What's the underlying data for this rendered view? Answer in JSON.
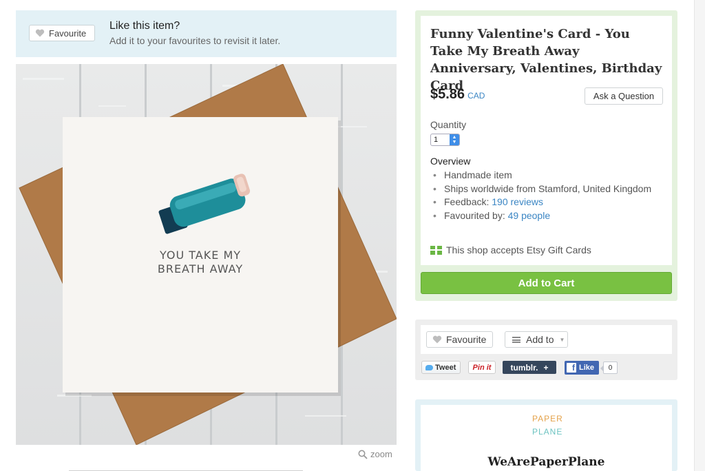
{
  "favourite_banner": {
    "button_label": "Favourite",
    "title": "Like this item?",
    "subtitle": "Add it to your favourites to revisit it later."
  },
  "product_image": {
    "card_text_line1": "YOU TAKE MY",
    "card_text_line2": "BREATH AWAY",
    "zoom_label": "zoom"
  },
  "listing": {
    "title": "Funny Valentine's Card - You Take My Breath Away Anniversary, Valentines, Birthday Card",
    "price": "$5.86",
    "currency": "CAD",
    "ask_button": "Ask a Question",
    "quantity_label": "Quantity",
    "quantity_value": "1",
    "overview_heading": "Overview",
    "overview": {
      "handmade": "Handmade item",
      "ships": "Ships worldwide from Stamford, United Kingdom",
      "feedback_label": "Feedback:",
      "feedback_link": "190 reviews",
      "favourited_label": "Favourited by:",
      "favourited_link": "49 people"
    },
    "gift_cards": "This shop accepts Etsy Gift Cards",
    "add_to_cart": "Add to Cart"
  },
  "share": {
    "favourite": "Favourite",
    "add_to": "Add to",
    "tweet": "Tweet",
    "pinit": "Pin it",
    "tumblr": "tumblr.",
    "tumblr_plus": "+",
    "fb_like": "Like",
    "fb_count": "0"
  },
  "shop": {
    "logo_line1": "PAPER",
    "logo_line2": "PLANE",
    "name": "WeArePaperPlane"
  },
  "colors": {
    "accent_blue": "#3b86c4",
    "cart_green": "#79c142",
    "banner_blue": "#e3f1f6",
    "panel_green": "#e4f2dd",
    "envelope_brown": "#b07a48"
  },
  "icons": [
    "heart-icon",
    "search-icon",
    "gift-card-icon",
    "list-icon",
    "twitter-bird-icon",
    "facebook-icon"
  ]
}
